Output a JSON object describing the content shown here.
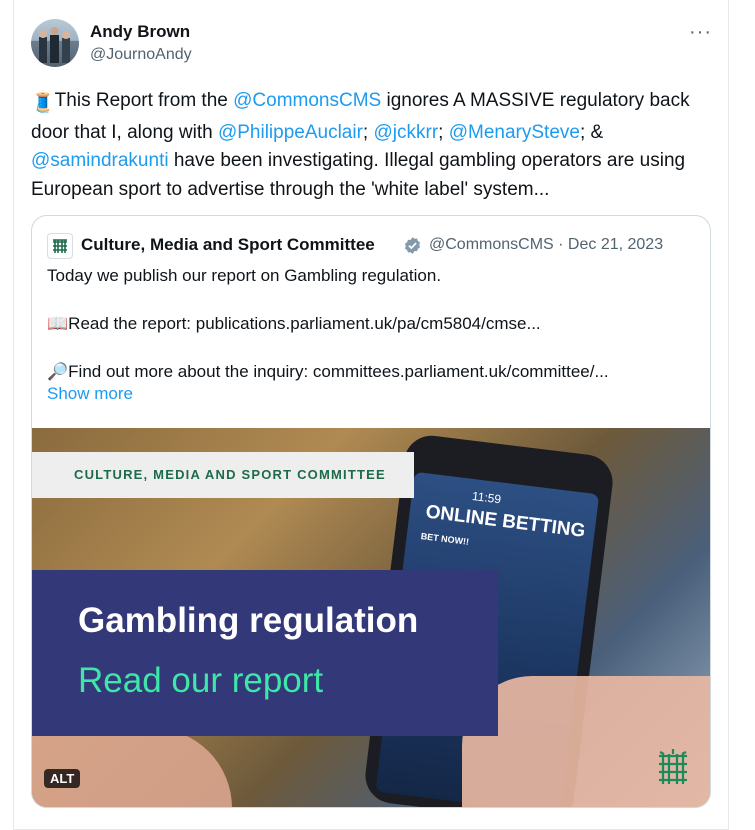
{
  "author": {
    "name": "Andy Brown",
    "handle": "@JournoAndy"
  },
  "tweet": {
    "emoji": "🧵",
    "seg1": "This Report from the ",
    "m1": "@CommonsCMS",
    "seg2": " ignores A MASSIVE regulatory back door that I, along with ",
    "m2": "@PhilippeAuclair",
    "seg3": "; ",
    "m3": "@jckkrr",
    "seg4": "; ",
    "m4": "@MenarySteve",
    "seg5": "; & ",
    "m5": "@samindrakunti",
    "seg6": " have been investigating. Illegal gambling operators are using European sport to advertise through the 'white label' system..."
  },
  "quote": {
    "name": "Culture, Media and Sport Committee",
    "handle": "@CommonsCMS",
    "sep": " · ",
    "date": "Dec 21, 2023",
    "text": "Today we publish our report on Gambling regulation.\n\n📖Read the report: publications.parliament.uk/pa/cm5804/cmse...\n\n🔎Find out more about the inquiry: committees.parliament.uk/committee/...",
    "show_more": "Show more"
  },
  "media": {
    "banner_top": "CULTURE, MEDIA AND SPORT COMMITTEE",
    "heading": "Gambling regulation",
    "subheading": "Read our report",
    "phone_time": "11:59",
    "phone_title": "ONLINE BETTING",
    "phone_sub": "BET NOW!!",
    "alt_label": "ALT"
  },
  "colors": {
    "link": "#1d9bf0",
    "banner_purple": "#333878",
    "banner_green": "#3ee6a8"
  }
}
